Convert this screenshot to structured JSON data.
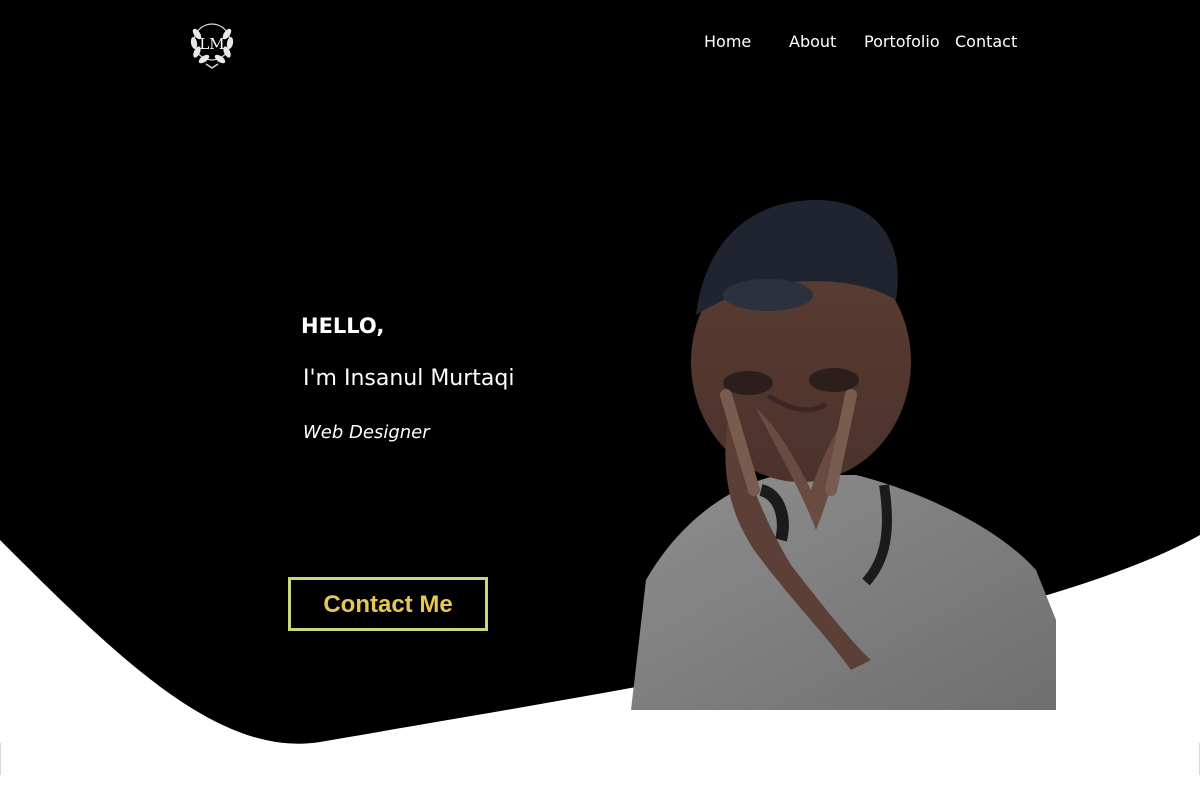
{
  "header": {
    "logo": {
      "icon": "laurel-monogram-icon",
      "letters": "LM"
    },
    "nav": [
      {
        "label": "Home"
      },
      {
        "label": "About"
      },
      {
        "label": "Portofolio"
      },
      {
        "label": "Contact"
      }
    ]
  },
  "hero": {
    "greeting": "HELLO,",
    "name": "I'm Insanul Murtaqi",
    "role": "Web Designer",
    "cta_label": "Contact Me"
  },
  "colors": {
    "hero_background": "#000000",
    "page_background": "#ffffff",
    "cta_text": "#e6c84f",
    "cta_border": "#c9d97a",
    "nav_text": "#ffffff"
  }
}
